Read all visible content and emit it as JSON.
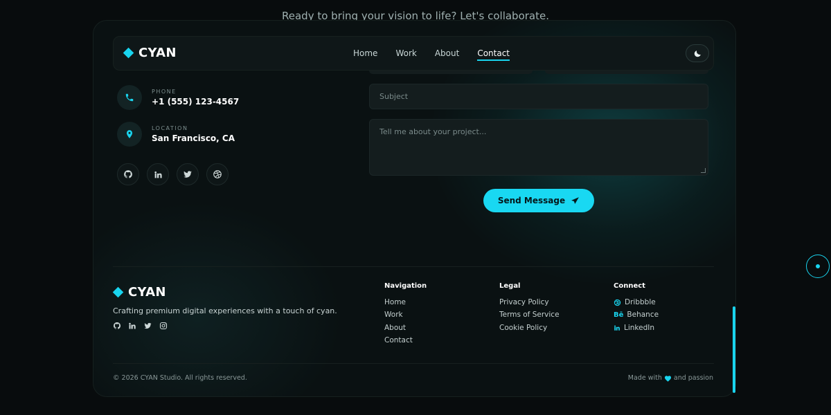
{
  "bg_tagline": "Ready to bring your vision to life? Let's collaborate.",
  "brand": {
    "name": "CYAN",
    "accent": "#19d4ee"
  },
  "nav": {
    "links": [
      {
        "label": "Home"
      },
      {
        "label": "Work"
      },
      {
        "label": "About"
      },
      {
        "label": "Contact",
        "active": true
      }
    ],
    "theme_toggle_icon": "moon-icon"
  },
  "contact": {
    "phone": {
      "label": "PHONE",
      "value": "+1 (555) 123-4567",
      "icon": "phone-icon"
    },
    "location": {
      "label": "LOCATION",
      "value": "San Francisco, CA",
      "icon": "location-pin-icon"
    },
    "socials": [
      "github-icon",
      "linkedin-icon",
      "twitter-icon",
      "dribbble-icon"
    ]
  },
  "form": {
    "subject_placeholder": "Subject",
    "message_placeholder": "Tell me about your project...",
    "send_label": "Send Message"
  },
  "footer": {
    "brand": "CYAN",
    "tagline": "Crafting premium digital experiences with a touch of cyan.",
    "socials": [
      "github-icon",
      "linkedin-icon",
      "twitter-icon",
      "instagram-icon"
    ],
    "columns": {
      "navigation": {
        "title": "Navigation",
        "items": [
          "Home",
          "Work",
          "About",
          "Contact"
        ]
      },
      "legal": {
        "title": "Legal",
        "items": [
          "Privacy Policy",
          "Terms of Service",
          "Cookie Policy"
        ]
      },
      "connect": {
        "title": "Connect",
        "items": [
          "Dribbble",
          "Behance",
          "LinkedIn"
        ]
      }
    },
    "copyright": "© 2026 CYAN Studio. All rights reserved.",
    "made_with_prefix": "Made with",
    "made_with_suffix": "and passion"
  }
}
